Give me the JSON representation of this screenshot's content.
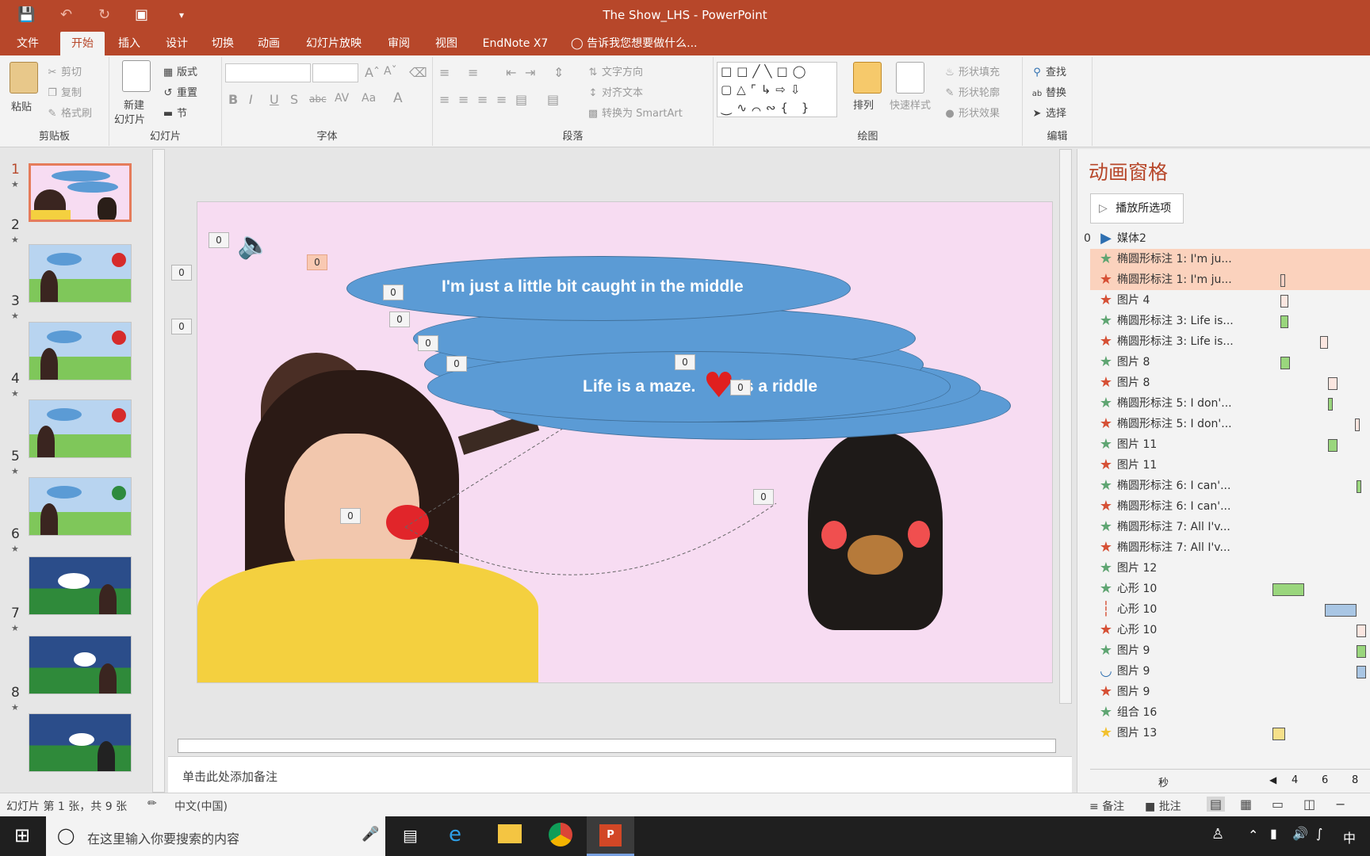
{
  "window": {
    "title": "The Show_LHS - PowerPoint"
  },
  "tabs": [
    "文件",
    "开始",
    "插入",
    "设计",
    "切换",
    "动画",
    "幻灯片放映",
    "审阅",
    "视图",
    "EndNote X7"
  ],
  "tell_me": "告诉我您想要做什么...",
  "ribbon": {
    "clipboard": {
      "paste": "粘贴",
      "cut": "剪切",
      "copy": "复制",
      "format_painter": "格式刷",
      "label": "剪贴板"
    },
    "slides": {
      "new_slide_1": "新建",
      "new_slide_2": "幻灯片",
      "layout": "版式",
      "reset": "重置",
      "section": "节",
      "label": "幻灯片"
    },
    "font": {
      "label": "字体"
    },
    "paragraph": {
      "text_direction": "文字方向",
      "align_text": "对齐文本",
      "smartart": "转换为 SmartArt",
      "label": "段落"
    },
    "drawing": {
      "arrange": "排列",
      "quick_styles": "快速样式",
      "shape_fill": "形状填充",
      "shape_outline": "形状轮廓",
      "shape_effects": "形状效果",
      "label": "绘图"
    },
    "editing": {
      "find": "查找",
      "replace": "替换",
      "select": "选择",
      "label": "编辑"
    }
  },
  "thumbnails": [
    "1",
    "2",
    "3",
    "4",
    "5",
    "6",
    "7",
    "8"
  ],
  "slide": {
    "bubble1": "I'm just a little bit caught in the middle",
    "bubble4_a": "Life is a maze.",
    "bubble4_b": "is a riddle",
    "badge": "0"
  },
  "notes_placeholder": "单击此处添加备注",
  "anim_pane": {
    "title": "动画窗格",
    "play_button": "播放所选项",
    "first_index": "0",
    "items": [
      {
        "label": "媒体2",
        "kind": "play",
        "color": "#2e6fb0"
      },
      {
        "label": "椭圆形标注 1: I'm ju...",
        "kind": "star",
        "color": "#5fa572"
      },
      {
        "label": "椭圆形标注 1: I'm ju...",
        "kind": "star",
        "color": "#d65035"
      },
      {
        "label": "图片 4",
        "kind": "star",
        "color": "#d65035"
      },
      {
        "label": "椭圆形标注 3: Life is...",
        "kind": "star",
        "color": "#5fa572"
      },
      {
        "label": "椭圆形标注 3: Life is...",
        "kind": "star",
        "color": "#d65035"
      },
      {
        "label": "图片 8",
        "kind": "star",
        "color": "#5fa572"
      },
      {
        "label": "图片 8",
        "kind": "star",
        "color": "#d65035"
      },
      {
        "label": "椭圆形标注 5: I don'...",
        "kind": "star",
        "color": "#5fa572"
      },
      {
        "label": "椭圆形标注 5: I don'...",
        "kind": "star",
        "color": "#d65035"
      },
      {
        "label": "图片 11",
        "kind": "star",
        "color": "#5fa572"
      },
      {
        "label": "图片 11",
        "kind": "star",
        "color": "#d65035"
      },
      {
        "label": "椭圆形标注 6: I can'...",
        "kind": "star",
        "color": "#5fa572"
      },
      {
        "label": "椭圆形标注 6: I can'...",
        "kind": "star",
        "color": "#d65035"
      },
      {
        "label": "椭圆形标注 7: All I'v...",
        "kind": "star",
        "color": "#5fa572"
      },
      {
        "label": "椭圆形标注 7: All I'v...",
        "kind": "star",
        "color": "#d65035"
      },
      {
        "label": "图片 12",
        "kind": "star",
        "color": "#5fa572"
      },
      {
        "label": "心形 10",
        "kind": "star",
        "color": "#5fa572"
      },
      {
        "label": "心形 10",
        "kind": "path",
        "color": "#d65035"
      },
      {
        "label": "心形 10",
        "kind": "star",
        "color": "#d65035"
      },
      {
        "label": "图片 9",
        "kind": "star",
        "color": "#5fa572"
      },
      {
        "label": "图片 9",
        "kind": "arc",
        "color": "#2e6fb0"
      },
      {
        "label": "图片 9",
        "kind": "star",
        "color": "#d65035"
      },
      {
        "label": "组合 16",
        "kind": "star",
        "color": "#5fa572"
      },
      {
        "label": "图片 13",
        "kind": "star",
        "color": "#f2c12e"
      }
    ],
    "timeline_unit": "秒",
    "timeline_ticks": [
      "4",
      "6",
      "8"
    ]
  },
  "status": {
    "slide_info": "幻灯片 第 1 张，共 9 张",
    "language": "中文(中国)",
    "notes": "备注",
    "comments": "批注"
  },
  "taskbar": {
    "search": "在这里输入你要搜索的内容",
    "ime": "中"
  }
}
